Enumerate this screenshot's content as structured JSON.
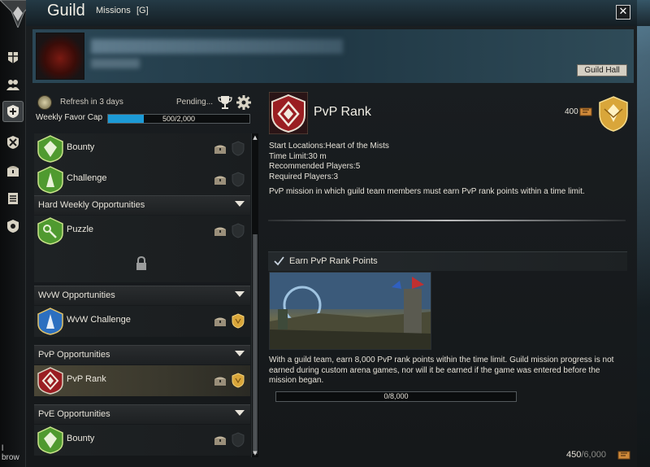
{
  "window": {
    "title": "Guild",
    "title_sub": "Missions",
    "title_tag": "[G]",
    "close_symbol": "✕",
    "guild_hall_label": "Guild Hall"
  },
  "favor": {
    "refresh_text": "Refresh in 3 days",
    "pending_text": "Pending...",
    "cap_label": "Weekly Favor Cap",
    "progress_text": "500/2,000",
    "progress_fraction": 0.25
  },
  "mission_list": {
    "rows_top": [
      {
        "label": "Bounty",
        "icon": "bounty-icon",
        "chest": "chest-icon",
        "slot": "empty"
      },
      {
        "label": "Challenge",
        "icon": "challenge-icon",
        "chest": "chest-icon",
        "slot": "empty"
      }
    ],
    "sections": [
      {
        "title": "Hard Weekly Opportunities",
        "rows": [
          {
            "label": "Puzzle",
            "icon": "puzzle-icon",
            "slot": "empty"
          }
        ],
        "locked": true
      },
      {
        "title": "WvW Opportunities",
        "rows": [
          {
            "label": "WvW Challenge",
            "icon": "wvw-icon",
            "slot": "gold"
          }
        ]
      },
      {
        "title": "PvP Opportunities",
        "rows": [
          {
            "label": "PvP Rank",
            "icon": "pvp-rank-icon",
            "slot": "gold",
            "selected": true
          }
        ]
      },
      {
        "title": "PvE Opportunities",
        "rows": [
          {
            "label": "Bounty",
            "icon": "bounty-icon",
            "slot": "empty"
          }
        ]
      }
    ]
  },
  "detail": {
    "title": "PvP Rank",
    "reward_amount": "400",
    "info_lines": [
      "Start Locations:Heart of the Mists",
      "Time Limit:30 m",
      "Recommended Players:5",
      "Required Players:3"
    ],
    "description": "PvP mission in which guild team members must earn PvP rank points within a time limit.",
    "objective_label": "Earn PvP Rank Points",
    "objective_description": "With a guild team, earn 8,000 PvP rank points within the time limit. Guild mission progress is not earned during custom arena games, nor will it be earned if the game was entered before the mission began.",
    "progress_text": "0/8,000",
    "progress_fraction": 0
  },
  "footer": {
    "total": "450",
    "cap": "/6,000"
  },
  "side": {
    "corner_text": "l\nbrow"
  },
  "colors": {
    "favor_bar": "#1c9ad6",
    "gold": "#d9a63a",
    "green_icon": "#4f9a2f",
    "blue_icon": "#2c6fc0",
    "red_icon": "#9a1e22"
  }
}
